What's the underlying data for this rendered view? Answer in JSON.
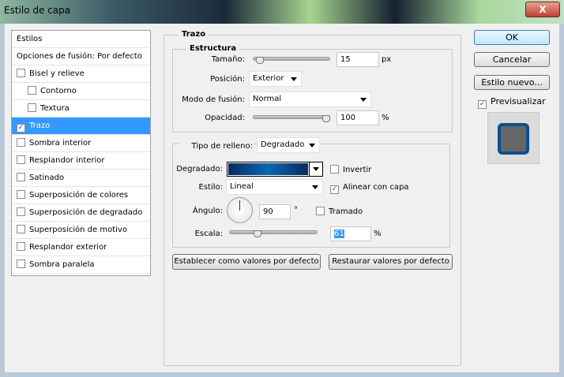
{
  "window": {
    "title": "Estilo de capa",
    "close": "X"
  },
  "sidebar": {
    "items": [
      {
        "label": "Estilos",
        "checkbox": false
      },
      {
        "label": "Opciones de fusión: Por defecto",
        "checkbox": false
      },
      {
        "label": "Bisel y relieve",
        "checkbox": true,
        "checked": false
      },
      {
        "label": "Contorno",
        "checkbox": true,
        "checked": false,
        "indent": true
      },
      {
        "label": "Textura",
        "checkbox": true,
        "checked": false,
        "indent": true
      },
      {
        "label": "Trazo",
        "checkbox": true,
        "checked": true,
        "selected": true
      },
      {
        "label": "Sombra interior",
        "checkbox": true,
        "checked": false
      },
      {
        "label": "Resplandor interior",
        "checkbox": true,
        "checked": false
      },
      {
        "label": "Satinado",
        "checkbox": true,
        "checked": false
      },
      {
        "label": "Superposición de colores",
        "checkbox": true,
        "checked": false
      },
      {
        "label": "Superposición de degradado",
        "checkbox": true,
        "checked": false
      },
      {
        "label": "Superposición de motivo",
        "checkbox": true,
        "checked": false
      },
      {
        "label": "Resplandor exterior",
        "checkbox": true,
        "checked": false
      },
      {
        "label": "Sombra paralela",
        "checkbox": true,
        "checked": false
      }
    ]
  },
  "trazo": {
    "title": "Trazo",
    "estructura": "Estructura",
    "size_label": "Tamaño:",
    "size": "15",
    "size_unit": "px",
    "size_slider_pct": 5,
    "position_label": "Posición:",
    "position": "Exterior",
    "blend_label": "Modo de fusión:",
    "blend": "Normal",
    "opacity_label": "Opacidad:",
    "opacity": "100",
    "opacity_unit": "%",
    "opacity_slider_pct": 100,
    "fill_type_label": "Tipo de relleno:",
    "fill_type": "Degradado",
    "gradient_label": "Degradado:",
    "gradient_colors": [
      "#0a2a5c",
      "#0a68b4",
      "#0a2a5c"
    ],
    "invert_label": "Invertir",
    "invert": false,
    "style_label": "Estilo:",
    "style": "Lineal",
    "align_label": "Alinear con capa",
    "align": true,
    "angle_label": "Ángulo:",
    "angle": "90",
    "angle_unit": "°",
    "dither_label": "Tramado",
    "dither": false,
    "scale_label": "Escala:",
    "scale": "61",
    "scale_unit": "%",
    "scale_slider_pct": 30,
    "set_default": "Establecer como valores por defecto",
    "reset_default": "Restaurar valores por defecto"
  },
  "actions": {
    "ok": "OK",
    "cancel": "Cancelar",
    "new_style": "Estilo nuevo...",
    "preview_label": "Previsualizar",
    "preview": true
  }
}
